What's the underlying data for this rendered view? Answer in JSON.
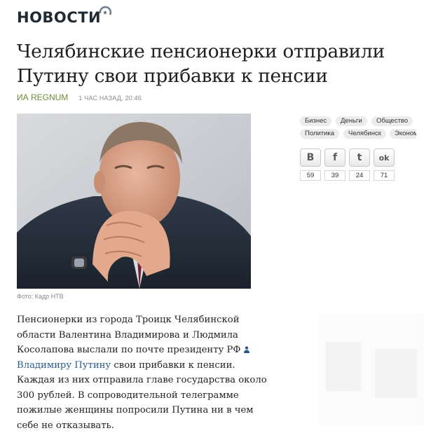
{
  "site": {
    "logo_text": "НОВОСТИ"
  },
  "article": {
    "title": "Челябинские пенсионерки отправили Путину свои прибавки к пенсии",
    "source": "ИА REGNUM",
    "published": "1 ЧАС НАЗАД, 20:46",
    "photo_caption": "Фото: Кадр НТВ",
    "body_before_link": "Пенсионерки из города Троицк Челябинской области Валентина Владимирова и Людмила Косолапова выслали по почте президенту РФ",
    "link_person": "Владимиру Путину",
    "body_after_link": "свои прибавки к пенсии. Каждая из них отправила главе государства около 300 рублей. В сопроводительной телеграмме пожилые женщины попросили Путина ни в чем себе не отказывать."
  },
  "tags": [
    "Бизнес",
    "Деньги",
    "Общество",
    "Политика",
    "Челябинск",
    "Эконом"
  ],
  "share": [
    {
      "network": "vk",
      "glyph": "B",
      "icon": "vk-icon",
      "count": "59"
    },
    {
      "network": "facebook",
      "glyph": "f",
      "icon": "facebook-icon",
      "count": "39"
    },
    {
      "network": "twitter",
      "glyph": "t",
      "icon": "twitter-icon",
      "count": "24"
    },
    {
      "network": "odnoklassniki",
      "glyph": "ok",
      "icon": "odnoklassniki-icon",
      "count": "71"
    }
  ],
  "colors": {
    "source_link": "#6b8f3a",
    "body_link": "#2a5b8a",
    "logo_accent": "#7a8a9a"
  }
}
